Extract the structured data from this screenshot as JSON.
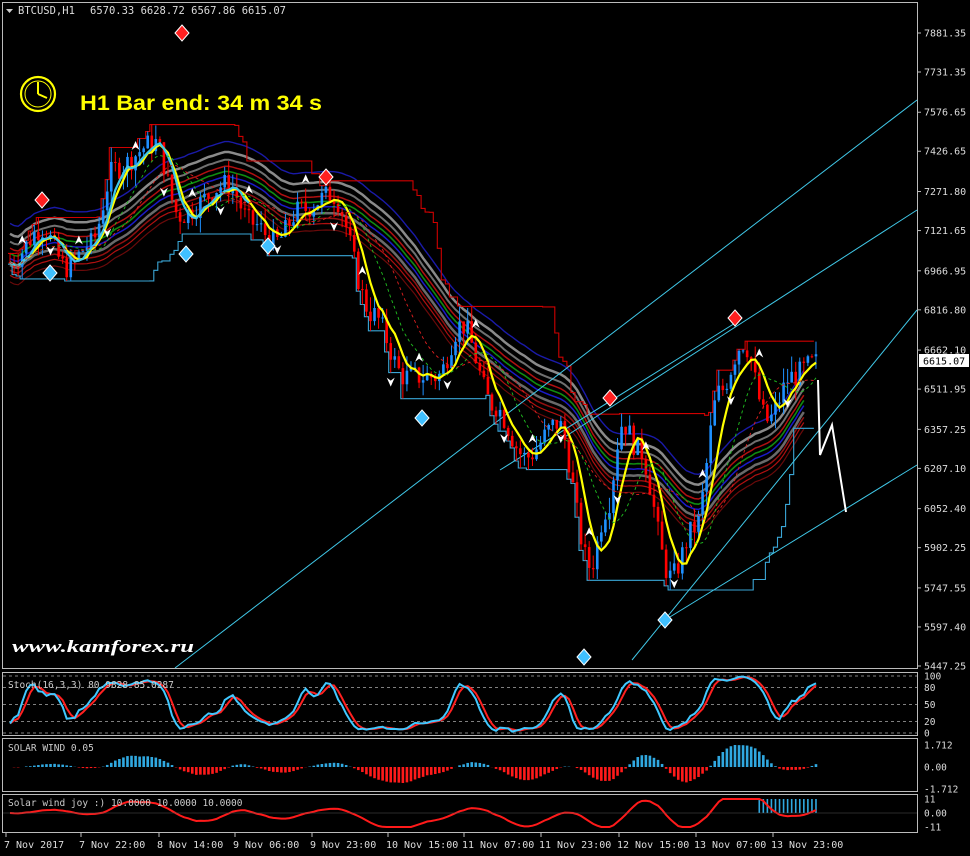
{
  "header": {
    "symbol": "BTCUSD,H1",
    "ohlc": "6570.33 6628.72 6567.86 6615.07"
  },
  "timer": {
    "label": "H1 Bar end: 34 m 34 s",
    "icon": "clock-icon",
    "color": "#ffff00"
  },
  "watermark": "www.kamforex.ru",
  "colors": {
    "background": "#000000",
    "bull": "#1e90ff",
    "bear": "#ff0000",
    "signal_yellow": "#ffff00",
    "cyan": "#40c8e8",
    "white": "#ffffff"
  },
  "price_axis": {
    "ticks": [
      "7881.35",
      "7731.35",
      "7576.65",
      "7426.65",
      "7271.80",
      "7121.65",
      "6966.95",
      "6816.80",
      "6662.10",
      "6511.95",
      "6357.25",
      "6207.10",
      "6052.40",
      "5902.25",
      "5747.55",
      "5597.40",
      "5447.25"
    ],
    "current": "6615.07"
  },
  "time_axis": {
    "labels": [
      "7 Nov 2017",
      "7 Nov 22:00",
      "8 Nov 14:00",
      "9 Nov 06:00",
      "9 Nov 23:00",
      "10 Nov 15:00",
      "11 Nov 07:00",
      "11 Nov 23:00",
      "12 Nov 15:00",
      "13 Nov 07:00",
      "13 Nov 23:00"
    ]
  },
  "panels": {
    "stoch": {
      "label": "Stoch(16,3,3) 80.9828 85.0287",
      "levels": [
        "100",
        "80",
        "50",
        "20",
        "0"
      ]
    },
    "solar": {
      "label": "SOLAR WIND 0.05",
      "levels": [
        "1.712",
        "0.00",
        "-1.712"
      ]
    },
    "joy": {
      "label": "Solar wind joy :) 10.0000 10.0000 10.0000",
      "levels": [
        "11",
        "0.00",
        "-11"
      ]
    }
  },
  "chart_data": {
    "type": "candlestick",
    "symbol": "BTCUSD",
    "timeframe": "H1",
    "ylim": [
      5447.25,
      7881.35
    ],
    "anchors": [
      {
        "t": 0,
        "p": 7000
      },
      {
        "t": 0.04,
        "p": 7130
      },
      {
        "t": 0.07,
        "p": 6980
      },
      {
        "t": 0.1,
        "p": 7070
      },
      {
        "t": 0.13,
        "p": 7360
      },
      {
        "t": 0.18,
        "p": 7460
      },
      {
        "t": 0.21,
        "p": 7180
      },
      {
        "t": 0.27,
        "p": 7300
      },
      {
        "t": 0.3,
        "p": 7150
      },
      {
        "t": 0.33,
        "p": 7080
      },
      {
        "t": 0.36,
        "p": 7200
      },
      {
        "t": 0.4,
        "p": 7260
      },
      {
        "t": 0.45,
        "p": 6800
      },
      {
        "t": 0.49,
        "p": 6560
      },
      {
        "t": 0.53,
        "p": 6560
      },
      {
        "t": 0.56,
        "p": 6760
      },
      {
        "t": 0.6,
        "p": 6450
      },
      {
        "t": 0.64,
        "p": 6250
      },
      {
        "t": 0.68,
        "p": 6380
      },
      {
        "t": 0.72,
        "p": 5830
      },
      {
        "t": 0.74,
        "p": 6050
      },
      {
        "t": 0.76,
        "p": 6380
      },
      {
        "t": 0.78,
        "p": 6280
      },
      {
        "t": 0.82,
        "p": 5790
      },
      {
        "t": 0.85,
        "p": 5980
      },
      {
        "t": 0.88,
        "p": 6500
      },
      {
        "t": 0.91,
        "p": 6690
      },
      {
        "t": 0.94,
        "p": 6390
      },
      {
        "t": 0.97,
        "p": 6560
      },
      {
        "t": 1,
        "p": 6615
      }
    ]
  }
}
